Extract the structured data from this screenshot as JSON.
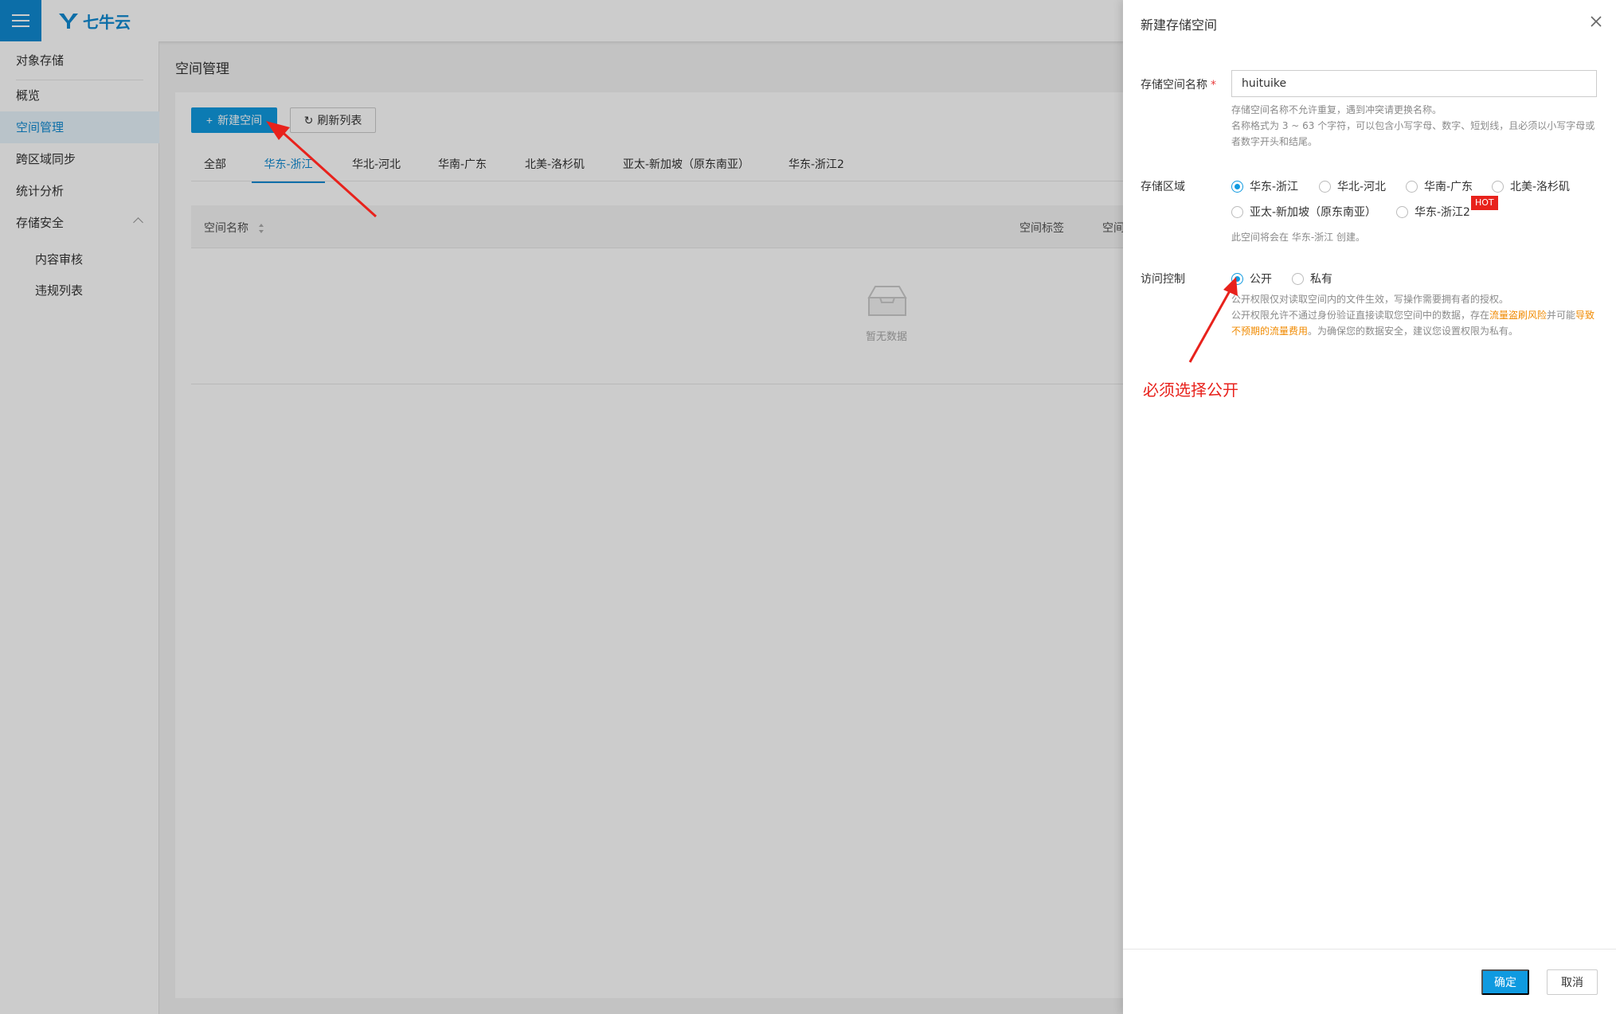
{
  "brand": {
    "logo_text": "七牛云",
    "accent": "#0f8ad2"
  },
  "sidebar": {
    "items": [
      {
        "label": "对象存储"
      },
      {
        "label": "概览"
      },
      {
        "label": "空间管理"
      },
      {
        "label": "跨区域同步"
      },
      {
        "label": "统计分析"
      },
      {
        "label": "存储安全"
      },
      {
        "label": "内容审核"
      },
      {
        "label": "违规列表"
      }
    ]
  },
  "main": {
    "title": "空间管理",
    "new_bucket_label": "新建空间",
    "refresh_label": "刷新列表",
    "tabs": [
      {
        "label": "全部"
      },
      {
        "label": "华东-浙江"
      },
      {
        "label": "华北-河北"
      },
      {
        "label": "华南-广东"
      },
      {
        "label": "北美-洛杉矶"
      },
      {
        "label": "亚太-新加坡（原东南亚）"
      },
      {
        "label": "华东-浙江2"
      }
    ],
    "table": {
      "col_name": "空间名称",
      "col_tag": "空间标签",
      "col_partial": "空间"
    },
    "empty_text": "暂无数据"
  },
  "drawer": {
    "title": "新建存储空间",
    "name_label": "存储空间名称",
    "required_mark": "*",
    "name_value": "huituike",
    "name_hint_1": "存储空间名称不允许重复，遇到冲突请更换名称。",
    "name_hint_2": "名称格式为 3 ~ 63 个字符，可以包含小写字母、数字、短划线，且必须以小写字母或者数字开头和结尾。",
    "region_label": "存储区域",
    "regions": [
      {
        "label": "华东-浙江",
        "checked": true
      },
      {
        "label": "华北-河北",
        "checked": false
      },
      {
        "label": "华南-广东",
        "checked": false
      },
      {
        "label": "北美-洛杉矶",
        "checked": false
      },
      {
        "label": "亚太-新加坡（原东南亚）",
        "checked": false
      },
      {
        "label": "华东-浙江2",
        "checked": false
      }
    ],
    "hot_badge": "HOT",
    "region_hint": "此空间将会在 华东-浙江 创建。",
    "access_label": "访问控制",
    "access_options": [
      {
        "label": "公开",
        "checked": true
      },
      {
        "label": "私有",
        "checked": false
      }
    ],
    "access_hint_1": "公开权限仅对读取空间内的文件生效，写操作需要拥有者的授权。",
    "access_hint_2_a": "公开权限允许不通过身份验证直接读取您空间中的数据，存在",
    "access_hint_2_warn1": "流量盗刷风险",
    "access_hint_2_b": "并可能",
    "access_hint_2_warn2": "导致不预期的流量费用",
    "access_hint_2_c": "。为确保您的数据安全，建议您设置权限为私有。",
    "annotation": "必须选择公开",
    "confirm_label": "确定",
    "cancel_label": "取消"
  }
}
